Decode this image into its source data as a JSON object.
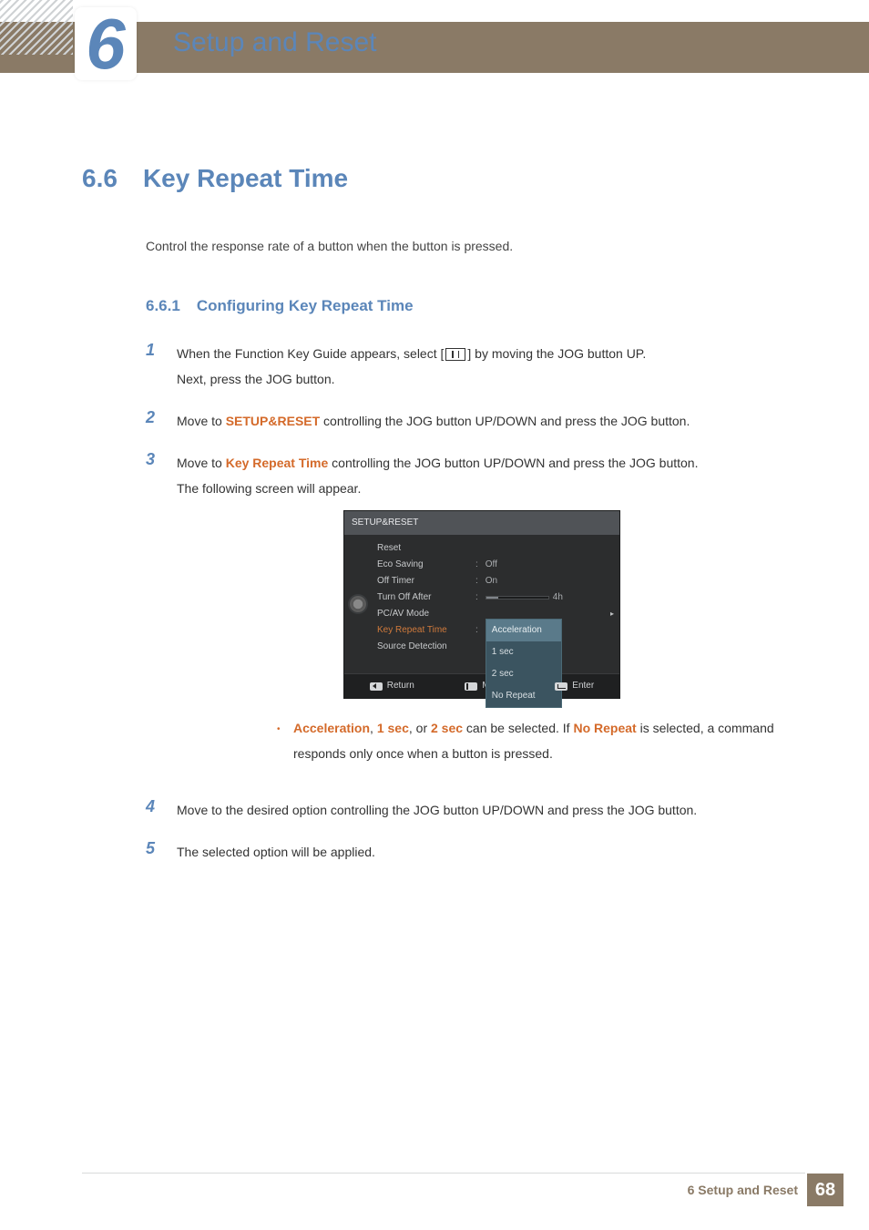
{
  "chapter": {
    "number": "6",
    "title": "Setup and Reset"
  },
  "section": {
    "number": "6.6",
    "title": "Key Repeat Time"
  },
  "intro": "Control the response rate of a button when the button is pressed.",
  "subsection": {
    "number": "6.6.1",
    "title": "Configuring Key Repeat Time"
  },
  "steps": {
    "s1a": "When the Function Key Guide appears, select ",
    "s1b": " by moving the JOG button UP.",
    "s1c": "Next, press the JOG button.",
    "s2a": "Move to ",
    "s2b": "SETUP&RESET",
    "s2c": " controlling the JOG button UP/DOWN and press the JOG button.",
    "s3a": "Move to ",
    "s3b": "Key Repeat Time",
    "s3c": " controlling the JOG button UP/DOWN and press the JOG button.",
    "s3d": "The following screen will appear.",
    "s4": "Move to the desired option controlling the JOG button UP/DOWN and press the JOG button.",
    "s5": "The selected option will be applied."
  },
  "osd": {
    "title": "SETUP&RESET",
    "items": {
      "reset": "Reset",
      "eco": "Eco Saving",
      "offtimer": "Off Timer",
      "turnoff": "Turn Off After",
      "pcav": "PC/AV Mode",
      "krt": "Key Repeat Time",
      "srcdet": "Source Detection"
    },
    "vals": {
      "off": "Off",
      "on": "On",
      "hrs": "4h"
    },
    "options": {
      "o1": "Acceleration",
      "o2": "1 sec",
      "o3": "2 sec",
      "o4": "No Repeat"
    },
    "footer": {
      "ret": "Return",
      "move": "Move",
      "enter": "Enter"
    }
  },
  "note": {
    "a": "Acceleration",
    "sep1": ", ",
    "b": "1 sec",
    "sep2": ", or ",
    "c": "2 sec",
    "mid": " can be selected. If ",
    "d": "No Repeat",
    "end": " is selected, a command responds only once when a button is pressed."
  },
  "footer": {
    "label": "6 Setup and Reset",
    "page": "68"
  }
}
